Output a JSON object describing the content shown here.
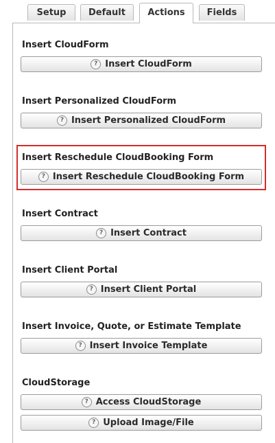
{
  "tabs": {
    "setup": "Setup",
    "default": "Default",
    "actions": "Actions",
    "fields": "Fields",
    "active": "Actions"
  },
  "sections": {
    "cloudform": {
      "heading": "Insert CloudForm",
      "button": "Insert CloudForm"
    },
    "personalized": {
      "heading": "Insert Personalized CloudForm",
      "button": "Insert Personalized CloudForm"
    },
    "reschedule": {
      "heading": "Insert Reschedule CloudBooking Form",
      "button": "Insert Reschedule CloudBooking Form",
      "highlighted": true
    },
    "contract": {
      "heading": "Insert Contract",
      "button": "Insert Contract"
    },
    "client_portal": {
      "heading": "Insert Client Portal",
      "button": "Insert Client Portal"
    },
    "invoice": {
      "heading": "Insert Invoice, Quote, or Estimate Template",
      "button": "Insert Invoice Template"
    },
    "cloudstorage": {
      "heading": "CloudStorage",
      "button_access": "Access CloudStorage",
      "button_upload": "Upload Image/File"
    }
  },
  "icons": {
    "help": "?"
  },
  "colors": {
    "highlight": "#d52b2b",
    "tab_border": "#b8b8b8",
    "button_border": "#9a9a9a"
  }
}
